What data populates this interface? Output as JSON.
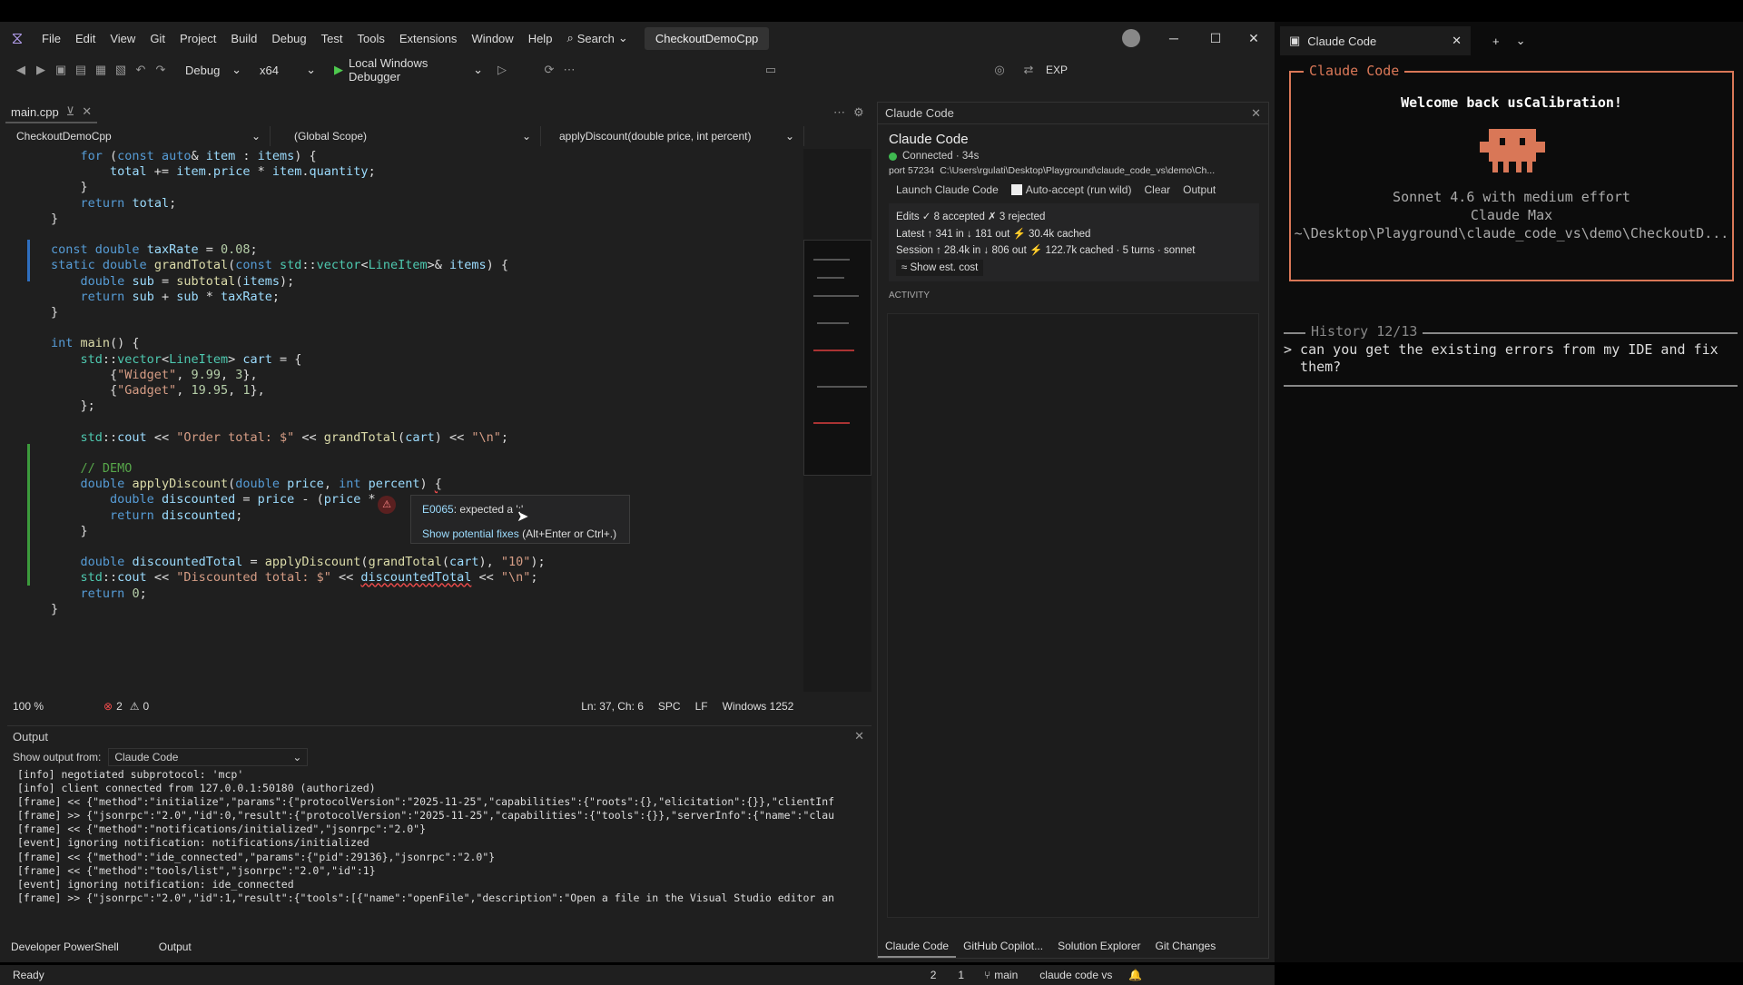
{
  "menu": {
    "items": [
      "File",
      "Edit",
      "View",
      "Git",
      "Project",
      "Build",
      "Debug",
      "Test",
      "Tools",
      "Extensions",
      "Window",
      "Help"
    ],
    "search": "Search",
    "solution_title": "CheckoutDemoCpp"
  },
  "toolbar": {
    "config": "Debug",
    "platform": "x64",
    "debugger": "Local Windows Debugger",
    "exp": "EXP"
  },
  "tab": {
    "name": "main.cpp"
  },
  "nav": {
    "project": "CheckoutDemoCpp",
    "scope": "(Global Scope)",
    "member": "applyDiscount(double price, int percent)"
  },
  "tooltip": {
    "error_code": "E0065",
    "message": ": expected a ';'",
    "fix": "Show potential fixes",
    "shortcut": " (Alt+Enter or Ctrl+.)"
  },
  "status": {
    "zoom": "100 %",
    "errors": "2",
    "warnings": "0",
    "position": "Ln: 37, Ch: 6",
    "spc": "SPC",
    "eol": "LF",
    "encoding": "Windows 1252"
  },
  "output": {
    "title": "Output",
    "from_label": "Show output from:",
    "source": "Claude Code",
    "lines": [
      "[info] negotiated subprotocol: 'mcp'",
      "[info] client connected from 127.0.0.1:50180 (authorized)",
      "[frame] << {\"method\":\"initialize\",\"params\":{\"protocolVersion\":\"2025-11-25\",\"capabilities\":{\"roots\":{},\"elicitation\":{}},\"clientInf",
      "[frame] >> {\"jsonrpc\":\"2.0\",\"id\":0,\"result\":{\"protocolVersion\":\"2025-11-25\",\"capabilities\":{\"tools\":{}},\"serverInfo\":{\"name\":\"clau",
      "[frame] << {\"method\":\"notifications/initialized\",\"jsonrpc\":\"2.0\"}",
      "[event] ignoring notification: notifications/initialized",
      "[frame] << {\"method\":\"ide_connected\",\"params\":{\"pid\":29136},\"jsonrpc\":\"2.0\"}",
      "[frame] << {\"method\":\"tools/list\",\"jsonrpc\":\"2.0\",\"id\":1}",
      "[event] ignoring notification: ide_connected",
      "[frame] >> {\"jsonrpc\":\"2.0\",\"id\":1,\"result\":{\"tools\":[{\"name\":\"openFile\",\"description\":\"Open a file in the Visual Studio editor an"
    ]
  },
  "bottom_tabs": [
    "Developer PowerShell",
    "Output"
  ],
  "statusbar": {
    "ready": "Ready",
    "changes": "2",
    "commits": "1",
    "branch": "main",
    "repo": "claude code vs"
  },
  "cc": {
    "header": "Claude Code",
    "title": "Claude Code",
    "status": "Connected · 34s",
    "port": "port 57234",
    "path": "C:\\Users\\rgulati\\Desktop\\Playground\\claude_code_vs\\demo\\Ch...",
    "launch": "Launch Claude Code",
    "auto": "Auto-accept (run wild)",
    "clear": "Clear",
    "output": "Output",
    "edits": "Edits  ✓ 8 accepted   ✗ 3 rejected",
    "latest": "Latest  ↑ 341 in  ↓ 181 out  ⚡ 30.4k cached",
    "session": "Session  ↑ 28.4k in  ↓ 806 out  ⚡ 122.7k cached  · 5 turns · sonnet",
    "est": "≈ Show est. cost",
    "activity": "ACTIVITY",
    "tabs": [
      "Claude Code",
      "GitHub Copilot...",
      "Solution Explorer",
      "Git Changes"
    ]
  },
  "terminal": {
    "tab": "Claude Code",
    "box_title": "Claude Code",
    "welcome": "Welcome back usCalibration!",
    "model": "Sonnet 4.6 with medium effort",
    "plan": "Claude Max",
    "cwd": "~\\Desktop\\Playground\\claude_code_vs\\demo\\CheckoutD...",
    "history": "History 12/13",
    "prompt": "> can you get the existing errors from my IDE and fix\n  them?"
  }
}
